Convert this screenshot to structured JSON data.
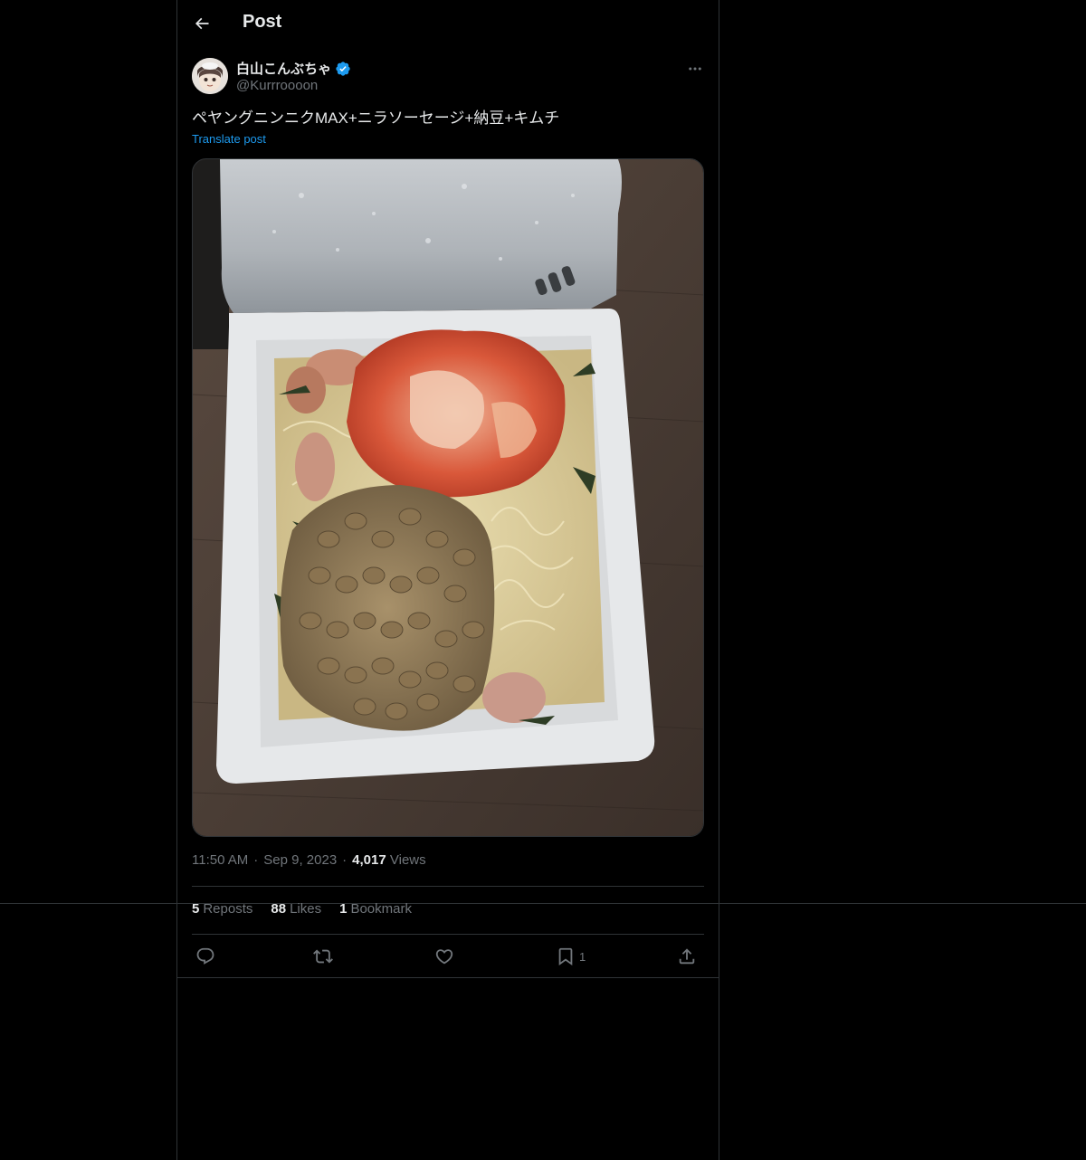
{
  "header": {
    "title": "Post"
  },
  "author": {
    "name": "白山こんぶちゃ",
    "handle": "@Kurrroooon",
    "verified": true
  },
  "post": {
    "text": "ペヤングニンニクMAX+ニラソーセージ+納豆+キムチ",
    "translate_label": "Translate post",
    "time": "11:50 AM",
    "date": "Sep 9, 2023",
    "views_count": "4,017",
    "views_label": "Views"
  },
  "stats": {
    "reposts_count": "5",
    "reposts_label": "Reposts",
    "likes_count": "88",
    "likes_label": "Likes",
    "bookmarks_count": "1",
    "bookmarks_label": "Bookmark"
  },
  "actions": {
    "bookmark_count": "1"
  },
  "colors": {
    "background": "#000000",
    "border": "#2f3336",
    "text_primary": "#e7e9ea",
    "text_secondary": "#71767b",
    "accent": "#1d9bf0"
  },
  "icons": {
    "back": "arrow-left-icon",
    "verified": "verified-badge-icon",
    "more": "more-horizontal-icon",
    "reply": "reply-icon",
    "repost": "repost-icon",
    "like": "heart-icon",
    "bookmark": "bookmark-icon",
    "share": "share-icon"
  }
}
